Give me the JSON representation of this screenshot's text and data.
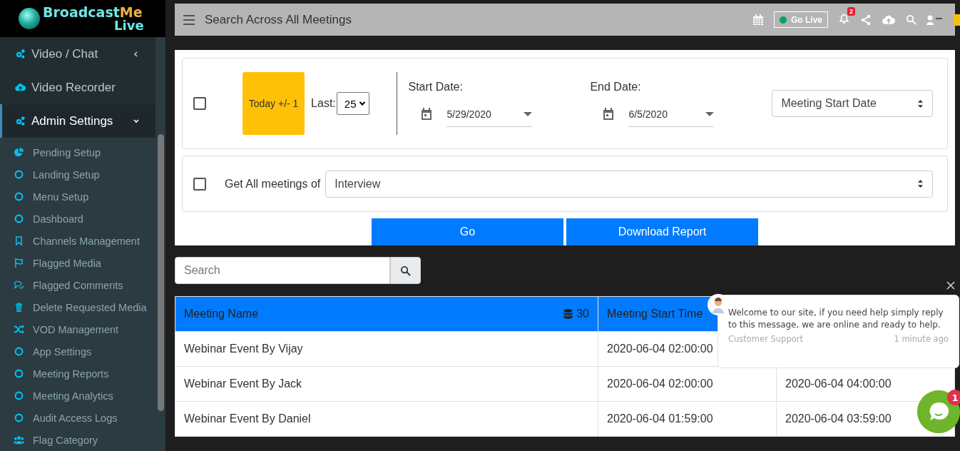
{
  "sidebar": {
    "logo": {
      "word_1": "Broadcast",
      "word_2": "Me",
      "word_3": "Live"
    },
    "items": [
      {
        "label": "Video / Chat",
        "kind": "gears",
        "expanded": false,
        "selected": false
      },
      {
        "label": "Video Recorder",
        "kind": "cloud",
        "selected": false
      },
      {
        "label": "Admin Settings",
        "kind": "gears",
        "expanded": true,
        "selected": true
      }
    ],
    "subitems": [
      {
        "label": "Pending Setup",
        "kind": "pie"
      },
      {
        "label": "Landing Setup",
        "kind": "circle"
      },
      {
        "label": "Menu Setup",
        "kind": "circle"
      },
      {
        "label": "Dashboard",
        "kind": "circle"
      },
      {
        "label": "Channels Management",
        "kind": "bookmark"
      },
      {
        "label": "Flagged Media",
        "kind": "flag"
      },
      {
        "label": "Flagged Comments",
        "kind": "comments"
      },
      {
        "label": "Delete Requested Media",
        "kind": "trash"
      },
      {
        "label": "VOD Management",
        "kind": "shuffle"
      },
      {
        "label": "App Settings",
        "kind": "circle"
      },
      {
        "label": "Meeting Reports",
        "kind": "circle"
      },
      {
        "label": "Meeting Analytics",
        "kind": "circle"
      },
      {
        "label": "Audit Access Logs",
        "kind": "circle"
      },
      {
        "label": "Flag Category",
        "kind": "users"
      }
    ]
  },
  "header": {
    "title": "Search Across All Meetings",
    "go_live": "Go Live",
    "notifications": "2"
  },
  "filters": {
    "date_range": {
      "checked": false,
      "today_button": "Today +/- 1",
      "last_label": "Last:",
      "last_value": "25",
      "start_label": "Start Date:",
      "start_value": "5/29/2020",
      "end_label": "End Date:",
      "end_value": "6/5/2020",
      "sort_by": "Meeting Start Date"
    },
    "meeting_type": {
      "checked": false,
      "label": "Get All meetings of",
      "value": "Interview"
    },
    "buttons": [
      "Go",
      "Download Report"
    ]
  },
  "search": {
    "placeholder": "Search"
  },
  "table": {
    "columns": [
      {
        "label": "Meeting Name",
        "count": "30"
      },
      {
        "label": "Meeting Start Time"
      }
    ],
    "rows": [
      [
        "Webinar Event By Vijay",
        "2020-06-04 02:00:00",
        null
      ],
      [
        "Webinar Event By Jack",
        "2020-06-04 02:00:00",
        "2020-06-04 04:00:00"
      ],
      [
        "Webinar Event By Daniel",
        "2020-06-04 01:59:00",
        "2020-06-04 03:59:00"
      ]
    ]
  },
  "chat": {
    "message": "Welcome to our site, if you need help simply reply to this message, we are online and ready to help.",
    "sender": "Customer Support",
    "time": "1 minute ago",
    "badge": "1"
  }
}
